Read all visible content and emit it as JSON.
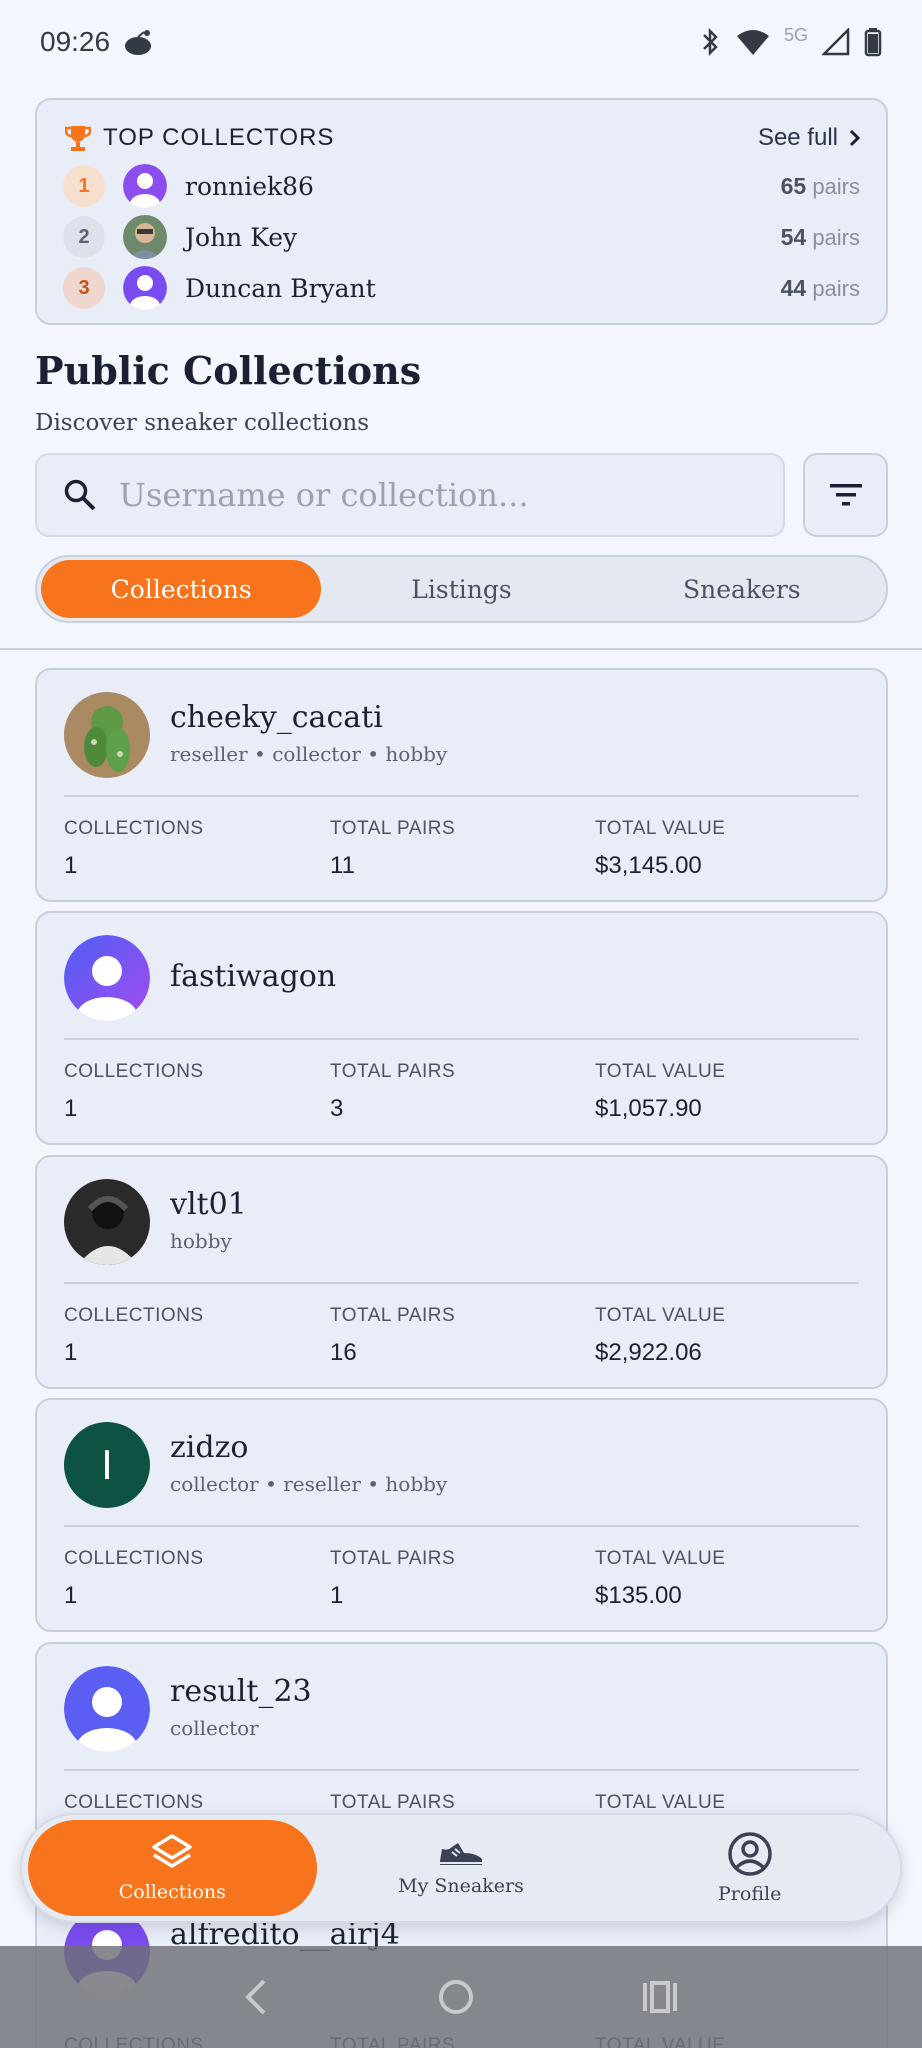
{
  "status_bar": {
    "time": "09:26",
    "network": "5G"
  },
  "top_collectors": {
    "title": "TOP COLLECTORS",
    "see_full": "See full",
    "entries": [
      {
        "rank": "1",
        "name": "ronniek86",
        "count": "65",
        "unit": "pairs"
      },
      {
        "rank": "2",
        "name": "John Key",
        "count": "54",
        "unit": "pairs"
      },
      {
        "rank": "3",
        "name": "Duncan Bryant",
        "count": "44",
        "unit": "pairs"
      }
    ]
  },
  "page": {
    "title": "Public Collections",
    "subtitle": "Discover sneaker collections",
    "search_placeholder": "Username or collection..."
  },
  "tabs": [
    "Collections",
    "Listings",
    "Sneakers"
  ],
  "stat_labels": {
    "collections": "COLLECTIONS",
    "pairs": "TOTAL PAIRS",
    "value": "TOTAL VALUE"
  },
  "users": [
    {
      "name": "cheeky_cacati",
      "tags": "reseller • collector • hobby",
      "collections": "1",
      "pairs": "11",
      "value": "$3,145.00"
    },
    {
      "name": "fastiwagon",
      "tags": "",
      "collections": "1",
      "pairs": "3",
      "value": "$1,057.90"
    },
    {
      "name": "vlt01",
      "tags": "hobby",
      "collections": "1",
      "pairs": "16",
      "value": "$2,922.06"
    },
    {
      "name": "zidzo",
      "tags": "collector • reseller • hobby",
      "collections": "1",
      "pairs": "1",
      "value": "$135.00",
      "initial": "I"
    },
    {
      "name": "result_23",
      "tags": "collector",
      "collections": "",
      "pairs": "",
      "value": ""
    },
    {
      "name": "alfredito__airj4",
      "tags": "",
      "collections": "",
      "pairs": "",
      "value": ""
    }
  ],
  "bottom_nav": [
    "Collections",
    "My Sneakers",
    "Profile"
  ],
  "colors": {
    "accent": "#f7741c",
    "card": "#e9edf7",
    "background": "#f3f6fc"
  }
}
